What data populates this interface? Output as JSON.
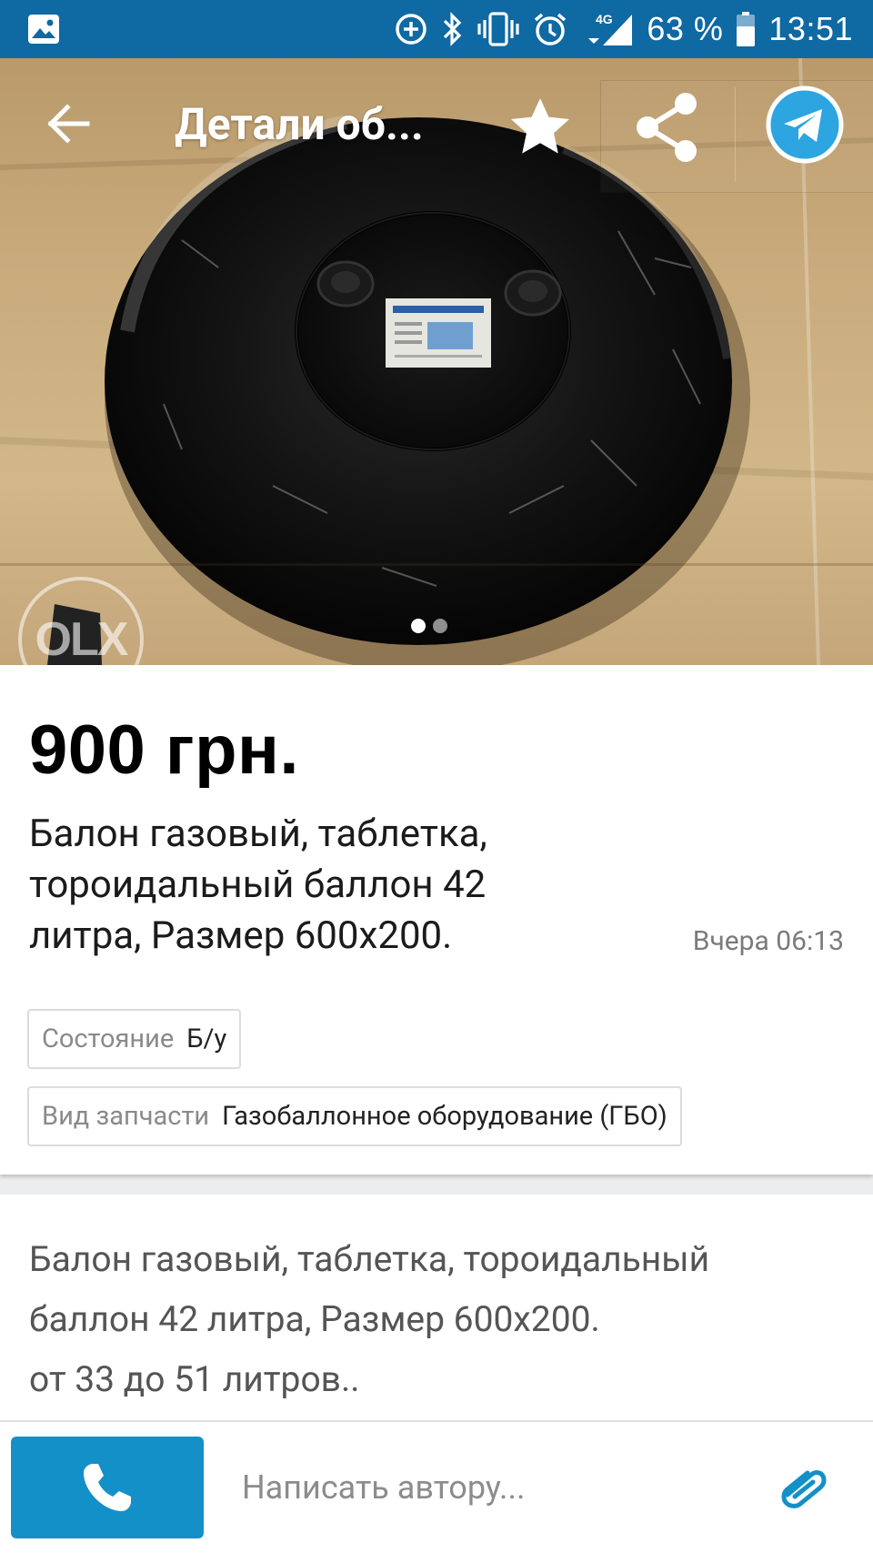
{
  "status_bar": {
    "battery": "63 %",
    "time": "13:51",
    "network": "4G"
  },
  "toolbar": {
    "title": "Детали об...",
    "back_icon": "arrow-back-icon",
    "favorite_icon": "star-icon",
    "share_icon": "share-icon",
    "telegram_icon": "telegram-icon"
  },
  "gallery": {
    "watermark": "OLX",
    "page_count": 2,
    "current_page": 1
  },
  "ad": {
    "price": "900 грн.",
    "title": "Балон газовый, таблетка, тороидальный баллон 42 литра, Размер 600х200.",
    "date": "Вчера 06:13",
    "params": [
      {
        "label": "Состояние",
        "value": "Б/у"
      },
      {
        "label": "Вид запчасти",
        "value": "Газобаллонное оборудование (ГБО)"
      }
    ],
    "description_lines": [
      "Балон газовый, таблетка, тороидальный",
      "баллон 42 литра, Размер 600х200.",
      "от 33 до 51 литров.."
    ]
  },
  "bottom_bar": {
    "call_icon": "phone-icon",
    "message_placeholder": "Написать автору...",
    "attach_icon": "paperclip-icon"
  },
  "colors": {
    "status_bar": "#0f69a3",
    "accent": "#1490c8",
    "telegram": "#2ca5e0"
  }
}
